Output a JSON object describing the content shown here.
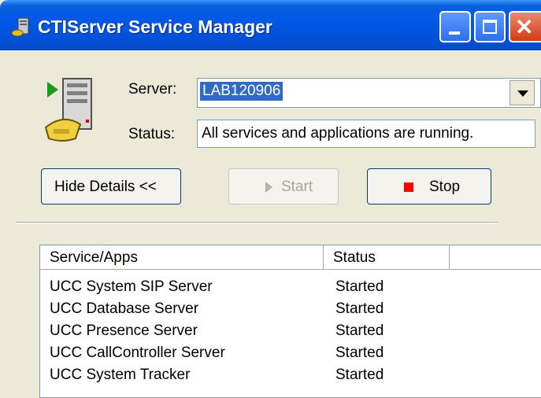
{
  "window": {
    "title": "CTIServer Service Manager"
  },
  "form": {
    "server_label": "Server:",
    "server_value": "LAB120906",
    "status_label": "Status:",
    "status_value": "All services and applications are running."
  },
  "buttons": {
    "hide_details": "Hide Details <<",
    "start": "Start",
    "stop": "Stop"
  },
  "list": {
    "columns": [
      "Service/Apps",
      "Status",
      ""
    ],
    "rows": [
      {
        "name": "UCC System SIP Server",
        "status": "Started"
      },
      {
        "name": "UCC Database Server",
        "status": "Started"
      },
      {
        "name": "UCC Presence Server",
        "status": "Started"
      },
      {
        "name": "UCC CallController Server",
        "status": "Started"
      },
      {
        "name": "UCC System Tracker",
        "status": "Started"
      }
    ]
  },
  "colors": {
    "titlebar": "#0058e6",
    "stop_icon": "#ff0000",
    "selection": "#316ac5"
  },
  "icons": [
    "app-icon",
    "minimize-icon",
    "maximize-icon",
    "close-icon",
    "server-phone-icon",
    "dropdown-arrow-icon",
    "play-icon",
    "stop-icon"
  ]
}
